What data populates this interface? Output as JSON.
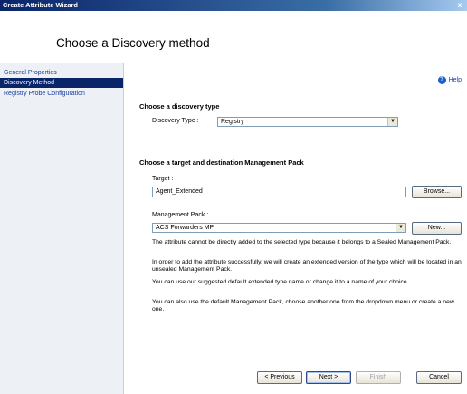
{
  "window": {
    "title": "Create Attribute Wizard",
    "close_glyph": "x"
  },
  "header": {
    "title": "Choose a Discovery method"
  },
  "sidebar": {
    "items": [
      {
        "label": "General Properties",
        "selected": false
      },
      {
        "label": "Discovery Method",
        "selected": true
      },
      {
        "label": "Registry Probe Configuration",
        "selected": false
      }
    ]
  },
  "help": {
    "label": "Help",
    "icon": "help-icon"
  },
  "discovery": {
    "heading": "Choose a discovery type",
    "type_label": "Discovery Type :",
    "type_value": "Registry"
  },
  "target_section": {
    "heading": "Choose a target and destination Management Pack",
    "target_label": "Target :",
    "target_value": "Agent_Extended",
    "browse_label": "Browse...",
    "mp_label": "Management Pack :",
    "mp_value": "ACS Forwarders MP",
    "new_label": "New..."
  },
  "paragraphs": [
    "The attribute cannot be directly added to the selected type because it belongs to a Sealed Management Pack.",
    "In order to add the attribute successfully, we will create an extended version of the type which will be located in an unsealed Management Pack.",
    "You can use our suggested default extended type name or change it to a name of your choice.",
    "You can also use the default Management Pack, choose another one from the dropdown menu or create a new one."
  ],
  "footer": {
    "previous_label": "< Previous",
    "next_label": "Next >",
    "finish_label": "Finish",
    "cancel_label": "Cancel"
  },
  "colors": {
    "titlebar": "#0a246a",
    "sidebar_bg": "#edf0f5",
    "selected_bg": "#0a246a",
    "link": "#1a3ea0"
  }
}
